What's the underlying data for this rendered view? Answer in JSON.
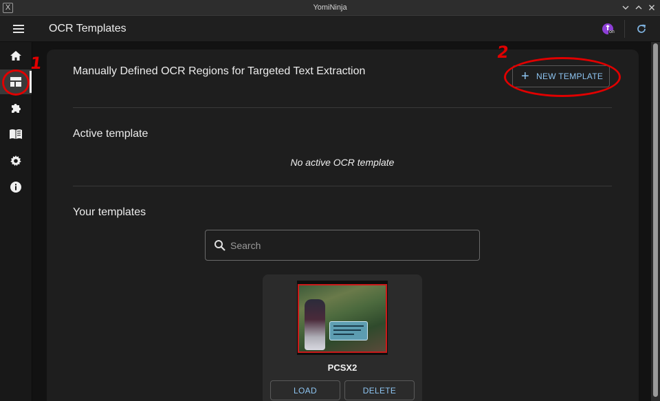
{
  "window": {
    "title": "YomiNinja",
    "logo_glyph": "X",
    "controls": [
      "chevron-down-icon",
      "chevron-up-icon",
      "close-icon"
    ]
  },
  "appbar": {
    "title": "OCR Templates",
    "extension_badge": "on",
    "menu_icon": "menu-icon",
    "refresh_icon": "refresh-icon"
  },
  "sidenav": {
    "items": [
      {
        "name": "home",
        "icon": "home-icon",
        "active": false
      },
      {
        "name": "ocr-templates",
        "icon": "template-icon",
        "active": true
      },
      {
        "name": "extensions",
        "icon": "puzzle-icon",
        "active": false
      },
      {
        "name": "dictionary",
        "icon": "book-icon",
        "active": false
      },
      {
        "name": "settings",
        "icon": "gear-icon",
        "active": false
      },
      {
        "name": "about",
        "icon": "info-icon",
        "active": false
      }
    ]
  },
  "annotations": {
    "step1": "1",
    "step2": "2",
    "color": "#e00000"
  },
  "main": {
    "headline": "Manually Defined OCR Regions for Targeted Text Extraction",
    "new_template_label": "NEW TEMPLATE",
    "active_section_title": "Active template",
    "no_active_message": "No active OCR template",
    "your_templates_title": "Your templates",
    "search_placeholder": "Search",
    "templates": [
      {
        "name": "PCSX2",
        "load_label": "LOAD",
        "delete_label": "DELETE"
      }
    ]
  },
  "colors": {
    "accent": "#8ec5f2",
    "background": "#121212",
    "card": "#1e1e1e",
    "template_card": "#2b2b2b"
  }
}
